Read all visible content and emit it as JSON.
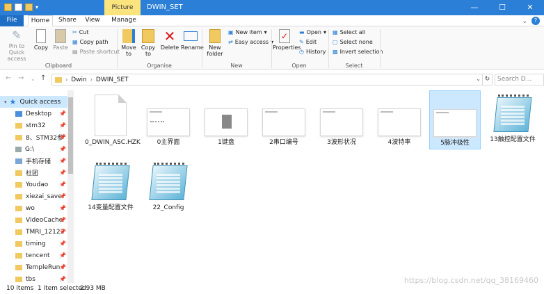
{
  "window": {
    "title": "DWIN_SET",
    "context_tab": "Picture Tools",
    "minimize": "—",
    "maximize": "☐",
    "close": "✕"
  },
  "tabs": [
    "File",
    "Home",
    "Share",
    "View",
    "Manage"
  ],
  "ribbon": {
    "clipboard": {
      "group_label": "Clipboard",
      "pin": "Pin to Quick access",
      "copy": "Copy",
      "paste": "Paste",
      "cut": "Cut",
      "copy_path": "Copy path",
      "paste_shortcut": "Paste shortcut"
    },
    "organize": {
      "group_label": "Organise",
      "move_to": "Move to",
      "copy_to": "Copy to",
      "delete": "Delete",
      "rename": "Rename"
    },
    "new": {
      "group_label": "New",
      "new_folder": "New folder",
      "new_item": "New item",
      "easy_access": "Easy access"
    },
    "open": {
      "group_label": "Open",
      "properties": "Properties",
      "open": "Open",
      "edit": "Edit",
      "history": "History"
    },
    "select": {
      "group_label": "Select",
      "select_all": "Select all",
      "select_none": "Select none",
      "invert": "Invert selection"
    }
  },
  "nav": {
    "back": "←",
    "forward": "→",
    "recent": "⌄",
    "up": "↑",
    "breadcrumb": [
      "Dwin",
      "DWIN_SET"
    ],
    "search_placeholder": "Search D..."
  },
  "sidebar": {
    "quick_access": "Quick access",
    "items": [
      {
        "label": "Desktop",
        "icon": "desktop-icon"
      },
      {
        "label": "stm32",
        "icon": "folder-icon"
      },
      {
        "label": "8、STM32参",
        "icon": "folder-icon"
      },
      {
        "label": "G:\\",
        "icon": "drive-icon"
      },
      {
        "label": "手机存储",
        "icon": "phone-storage-icon"
      },
      {
        "label": "社团",
        "icon": "folder-icon"
      },
      {
        "label": "Youdao",
        "icon": "folder-icon"
      },
      {
        "label": "xiezai_save",
        "icon": "folder-icon"
      },
      {
        "label": "wo",
        "icon": "folder-icon"
      },
      {
        "label": "VideoCache",
        "icon": "folder-icon"
      },
      {
        "label": "TMRI_12123",
        "icon": "folder-icon"
      },
      {
        "label": "timing",
        "icon": "folder-icon"
      },
      {
        "label": "tencent",
        "icon": "folder-icon"
      },
      {
        "label": "TempleRun",
        "icon": "folder-icon"
      },
      {
        "label": "tbs",
        "icon": "folder-icon"
      }
    ]
  },
  "files": [
    {
      "name": "0_DWIN_ASC.HZK",
      "type": "document"
    },
    {
      "name": "0主界面",
      "type": "image"
    },
    {
      "name": "1键盘",
      "type": "image"
    },
    {
      "name": "2串口编号",
      "type": "image"
    },
    {
      "name": "3波形状况",
      "type": "image"
    },
    {
      "name": "4波特率",
      "type": "image"
    },
    {
      "name": "5脉冲极性",
      "type": "image",
      "selected": true
    },
    {
      "name": "13触控配置文件",
      "type": "notepad"
    },
    {
      "name": "14变量配置文件",
      "type": "notepad"
    },
    {
      "name": "22_Config",
      "type": "notepad"
    }
  ],
  "status": {
    "count": "10 items",
    "selected": "1 item selected",
    "size": "2.93 MB"
  },
  "watermark": "https://blog.csdn.net/qq_38169460"
}
